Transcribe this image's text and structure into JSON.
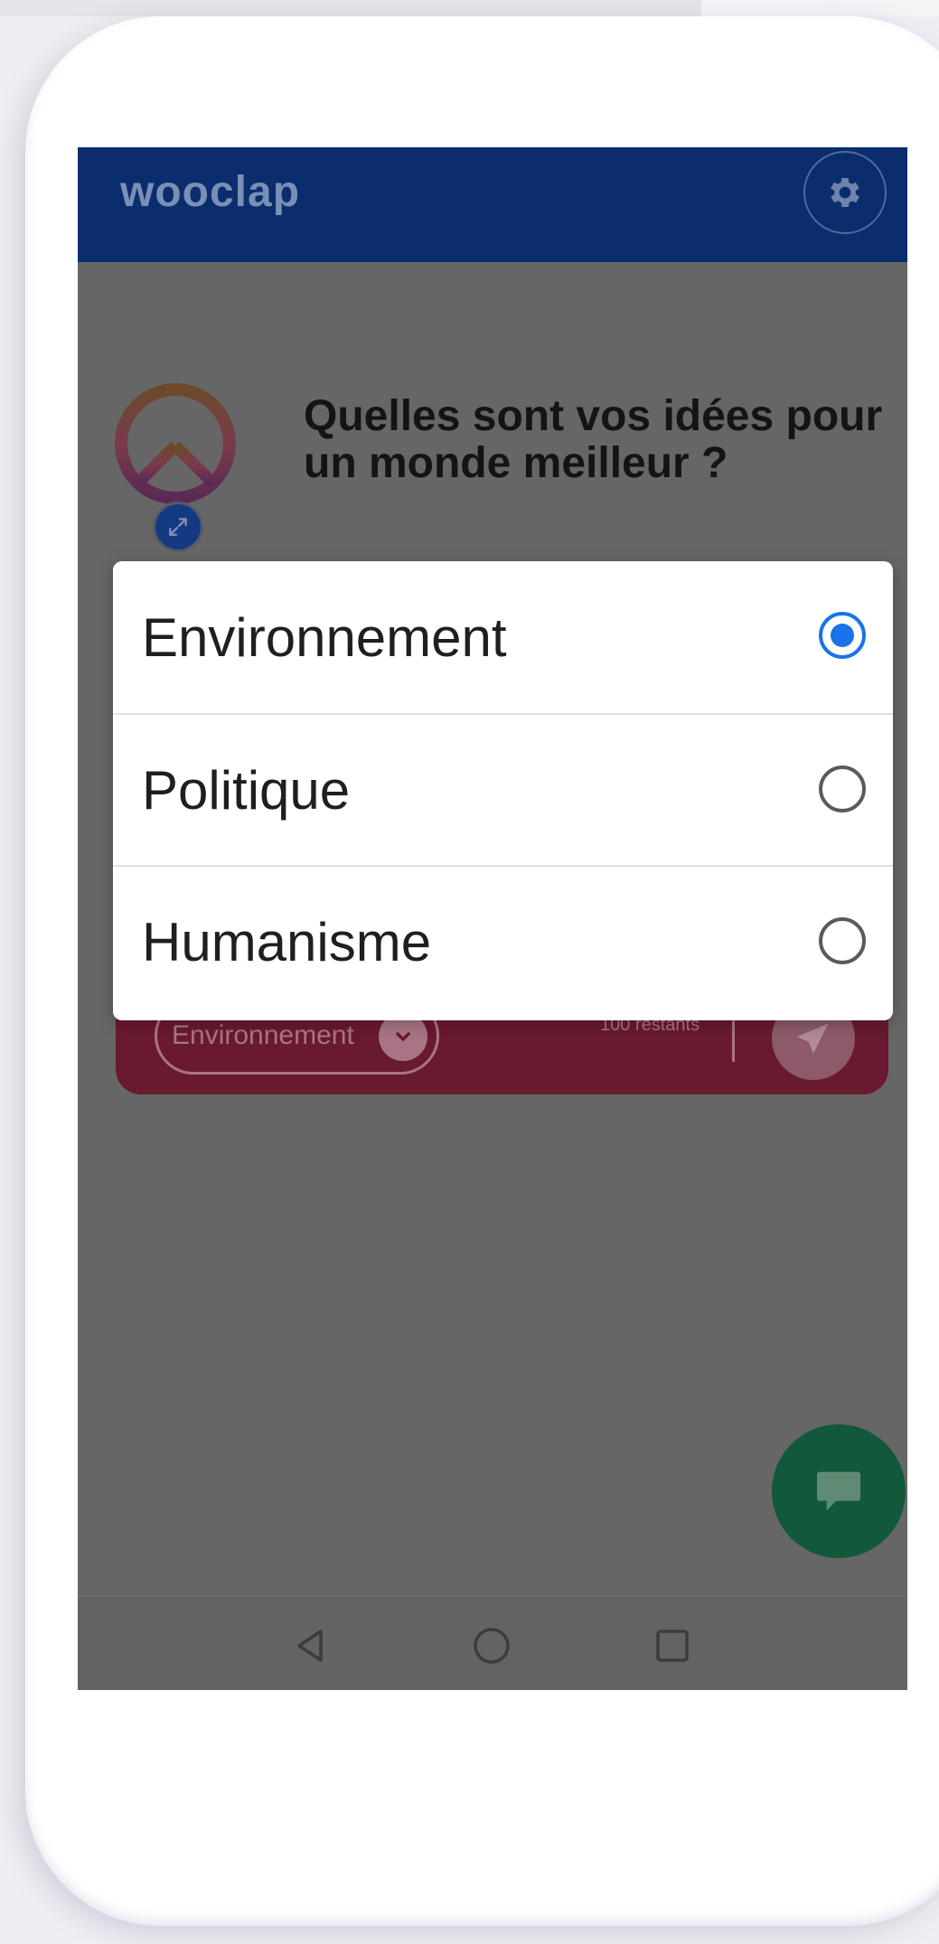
{
  "header": {
    "brand": "wooclap",
    "settings_icon": "gear-icon"
  },
  "question": {
    "text": "Quelles sont vos idées pour un monde meilleur ?"
  },
  "answer_bar": {
    "category": "Environnement",
    "remaining": "100 restants"
  },
  "dialog": {
    "selected_index": 0,
    "options": [
      {
        "label": "Environnement",
        "checked": true
      },
      {
        "label": "Politique",
        "checked": false
      },
      {
        "label": "Humanisme",
        "checked": false
      }
    ]
  },
  "colors": {
    "header_bg": "#0a2d6e",
    "accent": "#1a73e8",
    "answer_bar": "#6a1a2e",
    "chat_fab": "#12583a"
  }
}
